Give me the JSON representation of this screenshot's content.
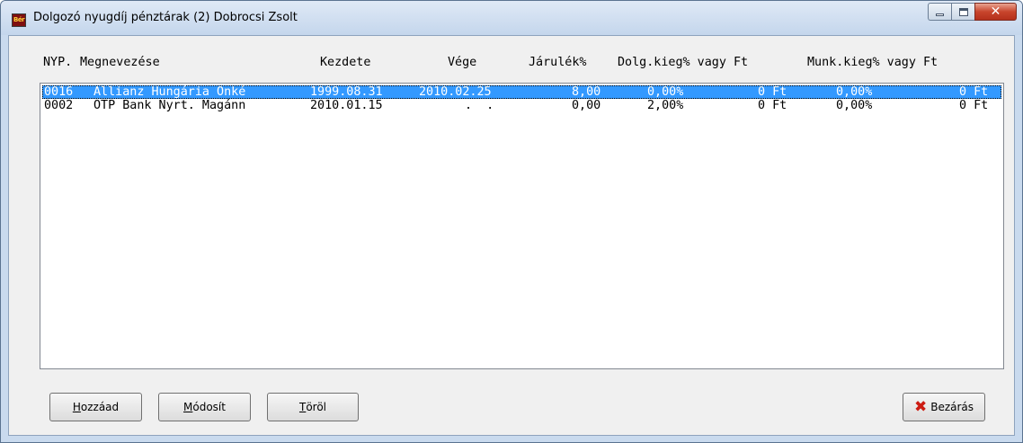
{
  "window": {
    "title": "Dolgozó nyugdíj pénztárak (2)  Dobrocsi Zsolt",
    "app_icon_text": "Bér"
  },
  "caption": {
    "minimize": "minimize",
    "maximize": "maximize",
    "close": "✕"
  },
  "columns": {
    "nyp": "NYP.",
    "name": "Megnevezése",
    "start": "Kezdete",
    "end": "Vége",
    "contrib": "Járulék%",
    "emp_extra": "Dolg.kieg% vagy Ft",
    "employer_extra": "Munk.kieg% vagy Ft"
  },
  "rows": [
    {
      "nyp": "0016",
      "name": "Allianz Hungária Önké",
      "start": "1999.08.31",
      "end": "2010.02.25",
      "contrib": "8,00",
      "emp_pct": "0,00%",
      "emp_ft": "0 Ft",
      "er_pct": "0,00%",
      "er_ft": "0 Ft",
      "selected": true
    },
    {
      "nyp": "0002",
      "name": "OTP Bank Nyrt. Magánn",
      "start": "2010.01.15",
      "end": ".  .",
      "contrib": "0,00",
      "emp_pct": "2,00%",
      "emp_ft": "0 Ft",
      "er_pct": "0,00%",
      "er_ft": "0 Ft",
      "selected": false
    }
  ],
  "buttons": {
    "add_first": "H",
    "add_rest": "ozzáad",
    "modify_first": "M",
    "modify_rest": "ódosít",
    "delete_first": "T",
    "delete_rest": "öröl",
    "close_label": "Bezárás",
    "close_icon": "✖"
  },
  "colors": {
    "selection": "#3399ff",
    "close_icon": "#cc1b12"
  }
}
